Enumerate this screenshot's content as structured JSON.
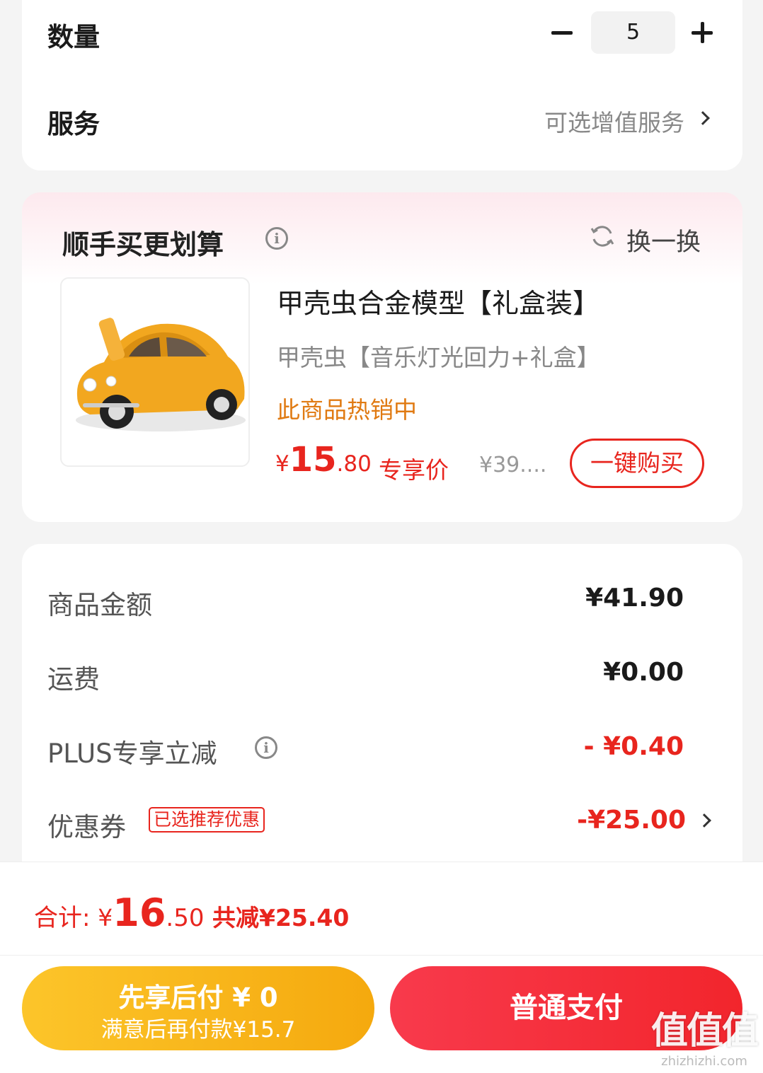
{
  "quantity_section": {
    "label": "数量",
    "value": "5"
  },
  "service_section": {
    "label": "服务",
    "value": "可选增值服务"
  },
  "bundle": {
    "title": "顺手买更划算",
    "refresh_label": "换一换",
    "product": {
      "title": "甲壳虫合金模型【礼盒装】",
      "variant": "甲壳虫【音乐灯光回力+礼盒】",
      "status": "此商品热销中",
      "price_symbol": "¥",
      "price_int": "15",
      "price_dec": ".80",
      "price_tag": "专享价",
      "original_price": "¥39....",
      "buy_label": "一键购买"
    }
  },
  "fees": {
    "goods_label": "商品金额",
    "goods_value": "¥41.90",
    "shipping_label": "运费",
    "shipping_value": "¥0.00",
    "plus_label": "PLUS专享立减",
    "plus_value": "- ¥0.40",
    "coupon_label": "优惠券",
    "coupon_tag": "已选推荐优惠",
    "coupon_value": "-¥25.00"
  },
  "footer": {
    "total_label": "合计: ",
    "total_symbol": "¥",
    "total_int": "16",
    "total_dec": ".50",
    "saved": " 共减¥25.40",
    "pay_later_line1": "先享后付 ¥ 0",
    "pay_later_line2": "满意后再付款¥15.7",
    "pay_normal": "普通支付"
  },
  "watermark": {
    "big": "值值值",
    "small": "zhizhizhi.com"
  },
  "colors": {
    "accent_red": "#e8251e",
    "hot_orange": "#e07a12",
    "pay_later_yellow": "#f5a90e",
    "pay_normal_red": "#f2252c"
  }
}
